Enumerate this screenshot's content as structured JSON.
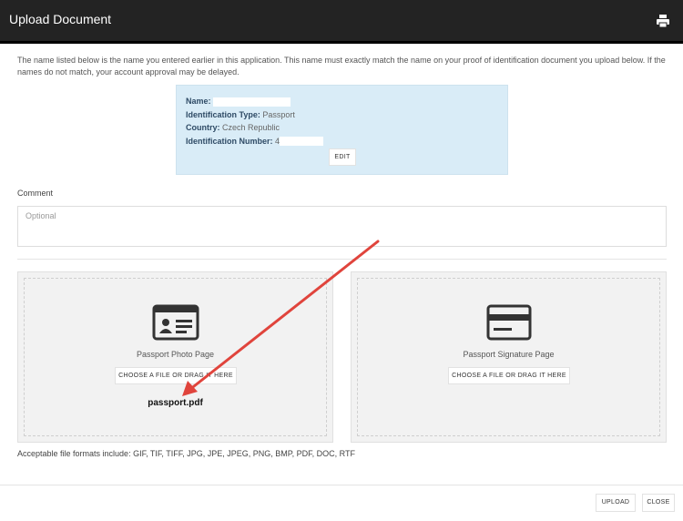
{
  "header": {
    "title": "Upload Document",
    "print_icon": "print-icon"
  },
  "intro": "The name listed below is the name you entered earlier in this application. This name must exactly match the name on your proof of identification document you upload below. If the names do not match, your account approval may be delayed.",
  "info": {
    "name_label": "Name:",
    "type_label": "Identification Type:",
    "type_value": "Passport",
    "country_label": "Country:",
    "country_value": "Czech Republic",
    "number_label": "Identification Number:",
    "number_value": "4",
    "edit": "EDIT"
  },
  "comment": {
    "label": "Comment",
    "placeholder": "Optional"
  },
  "zones": [
    {
      "label": "Passport Photo Page",
      "button": "CHOOSE A FILE OR DRAG IT HERE",
      "file": "passport.pdf"
    },
    {
      "label": "Passport Signature Page",
      "button": "CHOOSE A FILE OR DRAG IT HERE"
    }
  ],
  "formats": "Acceptable file formats include: GIF, TIF, TIFF, JPG, JPE, JPEG, PNG, BMP, PDF, DOC, RTF",
  "footer": {
    "upload": "UPLOAD",
    "close": "CLOSE"
  },
  "colors": {
    "header": "#232323",
    "info_bg": "#d9ecf7",
    "arrow": "#e0443c"
  }
}
